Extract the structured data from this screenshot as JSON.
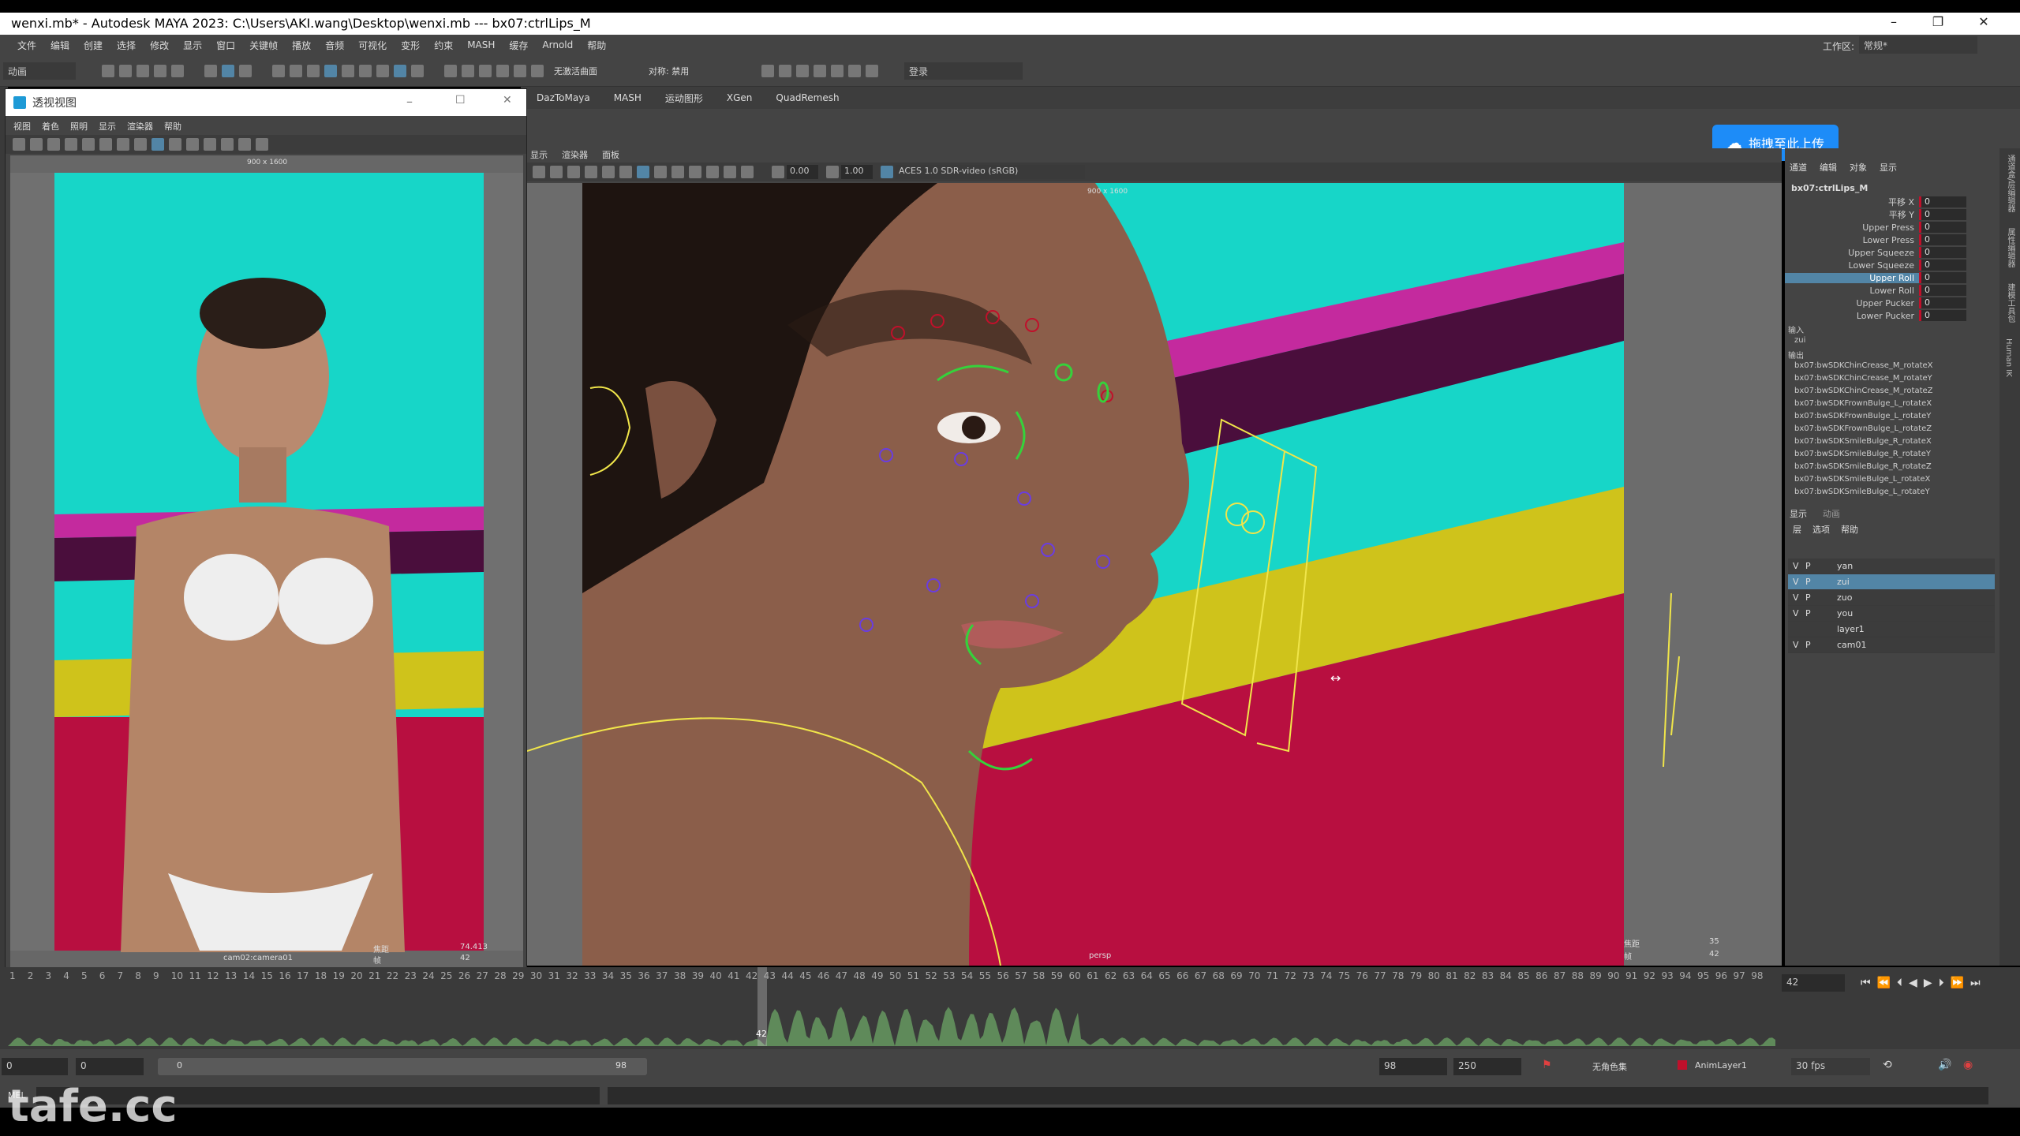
{
  "window": {
    "title": "wenxi.mb* - Autodesk MAYA 2023: C:\\Users\\AKI.wang\\Desktop\\wenxi.mb  ---  bx07:ctrlLips_M",
    "min": "–",
    "max": "❐",
    "close": "✕"
  },
  "menubar": {
    "items": [
      "文件",
      "编辑",
      "创建",
      "选择",
      "修改",
      "显示",
      "窗口",
      "关键帧",
      "播放",
      "音频",
      "可视化",
      "变形",
      "约束",
      "MASH",
      "缓存",
      "Arnold",
      "帮助"
    ],
    "workspace_label": "工作区:",
    "workspace_value": "常规*"
  },
  "statusline": {
    "mode_value": "动画",
    "live_surface": "无激活曲面",
    "symmetry": "对称: 禁用",
    "login": "登录"
  },
  "shelf": {
    "tabs": [
      "DazToMaya",
      "MASH",
      "运动图形",
      "XGen",
      "QuadRemesh"
    ]
  },
  "cloud_button": "拖拽至此上传",
  "float_window": {
    "title": "透视视图",
    "menu": [
      "视图",
      "着色",
      "照明",
      "显示",
      "渲染器",
      "帮助"
    ],
    "resolution": "900 x 1600",
    "camera_label": "cam02:camera01",
    "hud_left": "焦距",
    "hud_value1": "74.413",
    "hud_frame_label": "帧",
    "hud_frame_value": "42"
  },
  "main_panel": {
    "menu": [
      "显示",
      "渲染器",
      "面板"
    ],
    "exposure": "0.00",
    "gamma": "1.00",
    "colorspace": "ACES 1.0 SDR-video (sRGB)",
    "resolution": "900 x 1600",
    "camera": "persp",
    "hud_focal_label": "焦距",
    "hud_focal_value": "35",
    "hud_frame_label": "帧",
    "hud_frame_value": "42"
  },
  "channel_box": {
    "tabs": [
      "通道",
      "编辑",
      "对象",
      "显示"
    ],
    "node": "bx07:ctrlLips_M",
    "attributes": [
      {
        "name": "平移 X",
        "value": "0",
        "selected": false
      },
      {
        "name": "平移 Y",
        "value": "0",
        "selected": false
      },
      {
        "name": "Upper Press",
        "value": "0",
        "selected": false
      },
      {
        "name": "Lower Press",
        "value": "0",
        "selected": false
      },
      {
        "name": "Upper Squeeze",
        "value": "0",
        "selected": false
      },
      {
        "name": "Lower Squeeze",
        "value": "0",
        "selected": false
      },
      {
        "name": "Upper Roll",
        "value": "0",
        "selected": true
      },
      {
        "name": "Lower Roll",
        "value": "0",
        "selected": false
      },
      {
        "name": "Upper Pucker",
        "value": "0",
        "selected": false
      },
      {
        "name": "Lower Pucker",
        "value": "0",
        "selected": false
      }
    ],
    "inputs_label": "输入",
    "inputs": [
      "zui"
    ],
    "outputs_label": "输出",
    "outputs": [
      "bx07:bwSDKChinCrease_M_rotateX",
      "bx07:bwSDKChinCrease_M_rotateY",
      "bx07:bwSDKChinCrease_M_rotateZ",
      "bx07:bwSDKFrownBulge_L_rotateX",
      "bx07:bwSDKFrownBulge_L_rotateY",
      "bx07:bwSDKFrownBulge_L_rotateZ",
      "bx07:bwSDKSmileBulge_R_rotateX",
      "bx07:bwSDKSmileBulge_R_rotateY",
      "bx07:bwSDKSmileBulge_R_rotateZ",
      "bx07:bwSDKSmileBulge_L_rotateX",
      "bx07:bwSDKSmileBulge_L_rotateY"
    ],
    "layer_tabs": [
      "显示",
      "动画"
    ],
    "layer_menu": [
      "层",
      "选项",
      "帮助"
    ],
    "layers": [
      {
        "v": "V",
        "p": "P",
        "name": "yan",
        "selected": false
      },
      {
        "v": "V",
        "p": "P",
        "name": "zui",
        "selected": true
      },
      {
        "v": "V",
        "p": "P",
        "name": "zuo",
        "selected": false
      },
      {
        "v": "V",
        "p": "P",
        "name": "you",
        "selected": false
      },
      {
        "v": "",
        "p": "",
        "name": "layer1",
        "selected": false
      },
      {
        "v": "V",
        "p": "P",
        "name": "cam01",
        "selected": false
      }
    ]
  },
  "right_strip_labels": [
    "通道盒/层编辑器",
    "属性编辑器",
    "建模工具包",
    "Human IK"
  ],
  "timeline": {
    "ticks": [
      "1",
      "2",
      "3",
      "4",
      "5",
      "6",
      "7",
      "8",
      "9",
      "10",
      "11",
      "12",
      "13",
      "14",
      "15",
      "16",
      "17",
      "18",
      "19",
      "20",
      "21",
      "22",
      "23",
      "24",
      "25",
      "26",
      "27",
      "28",
      "29",
      "30",
      "31",
      "32",
      "33",
      "34",
      "35",
      "36",
      "37",
      "38",
      "39",
      "40",
      "41",
      "42",
      "43",
      "44",
      "45",
      "46",
      "47",
      "48",
      "49",
      "50",
      "51",
      "52",
      "53",
      "54",
      "55",
      "56",
      "57",
      "58",
      "59",
      "60",
      "61",
      "62",
      "63",
      "64",
      "65",
      "66",
      "67",
      "68",
      "69",
      "70",
      "71",
      "72",
      "73",
      "74",
      "75",
      "76",
      "77",
      "78",
      "79",
      "80",
      "81",
      "82",
      "83",
      "84",
      "85",
      "86",
      "87",
      "88",
      "89",
      "90",
      "91",
      "92",
      "93",
      "94",
      "95",
      "96",
      "97",
      "98"
    ],
    "current_frame": "42",
    "current_frame_field": "42"
  },
  "range": {
    "start": "0",
    "anim_start": "0",
    "slider_start": "0",
    "slider_end": "98",
    "end": "98",
    "anim_end": "250",
    "charset": "无角色集",
    "anim_layer": "AnimLayer1",
    "fps": "30 fps"
  },
  "cmdline": {
    "label": "MEL"
  },
  "watermark": "tafe.cc",
  "colors": {
    "maya_bg": "#444444",
    "selection_blue": "#5285a6",
    "keyed_red": "#c0102b",
    "bg_cyan": "#17d6c8",
    "bg_magenta": "#c42a9e",
    "bg_yellow": "#cfc31b",
    "bg_crimson": "#b80f40"
  }
}
